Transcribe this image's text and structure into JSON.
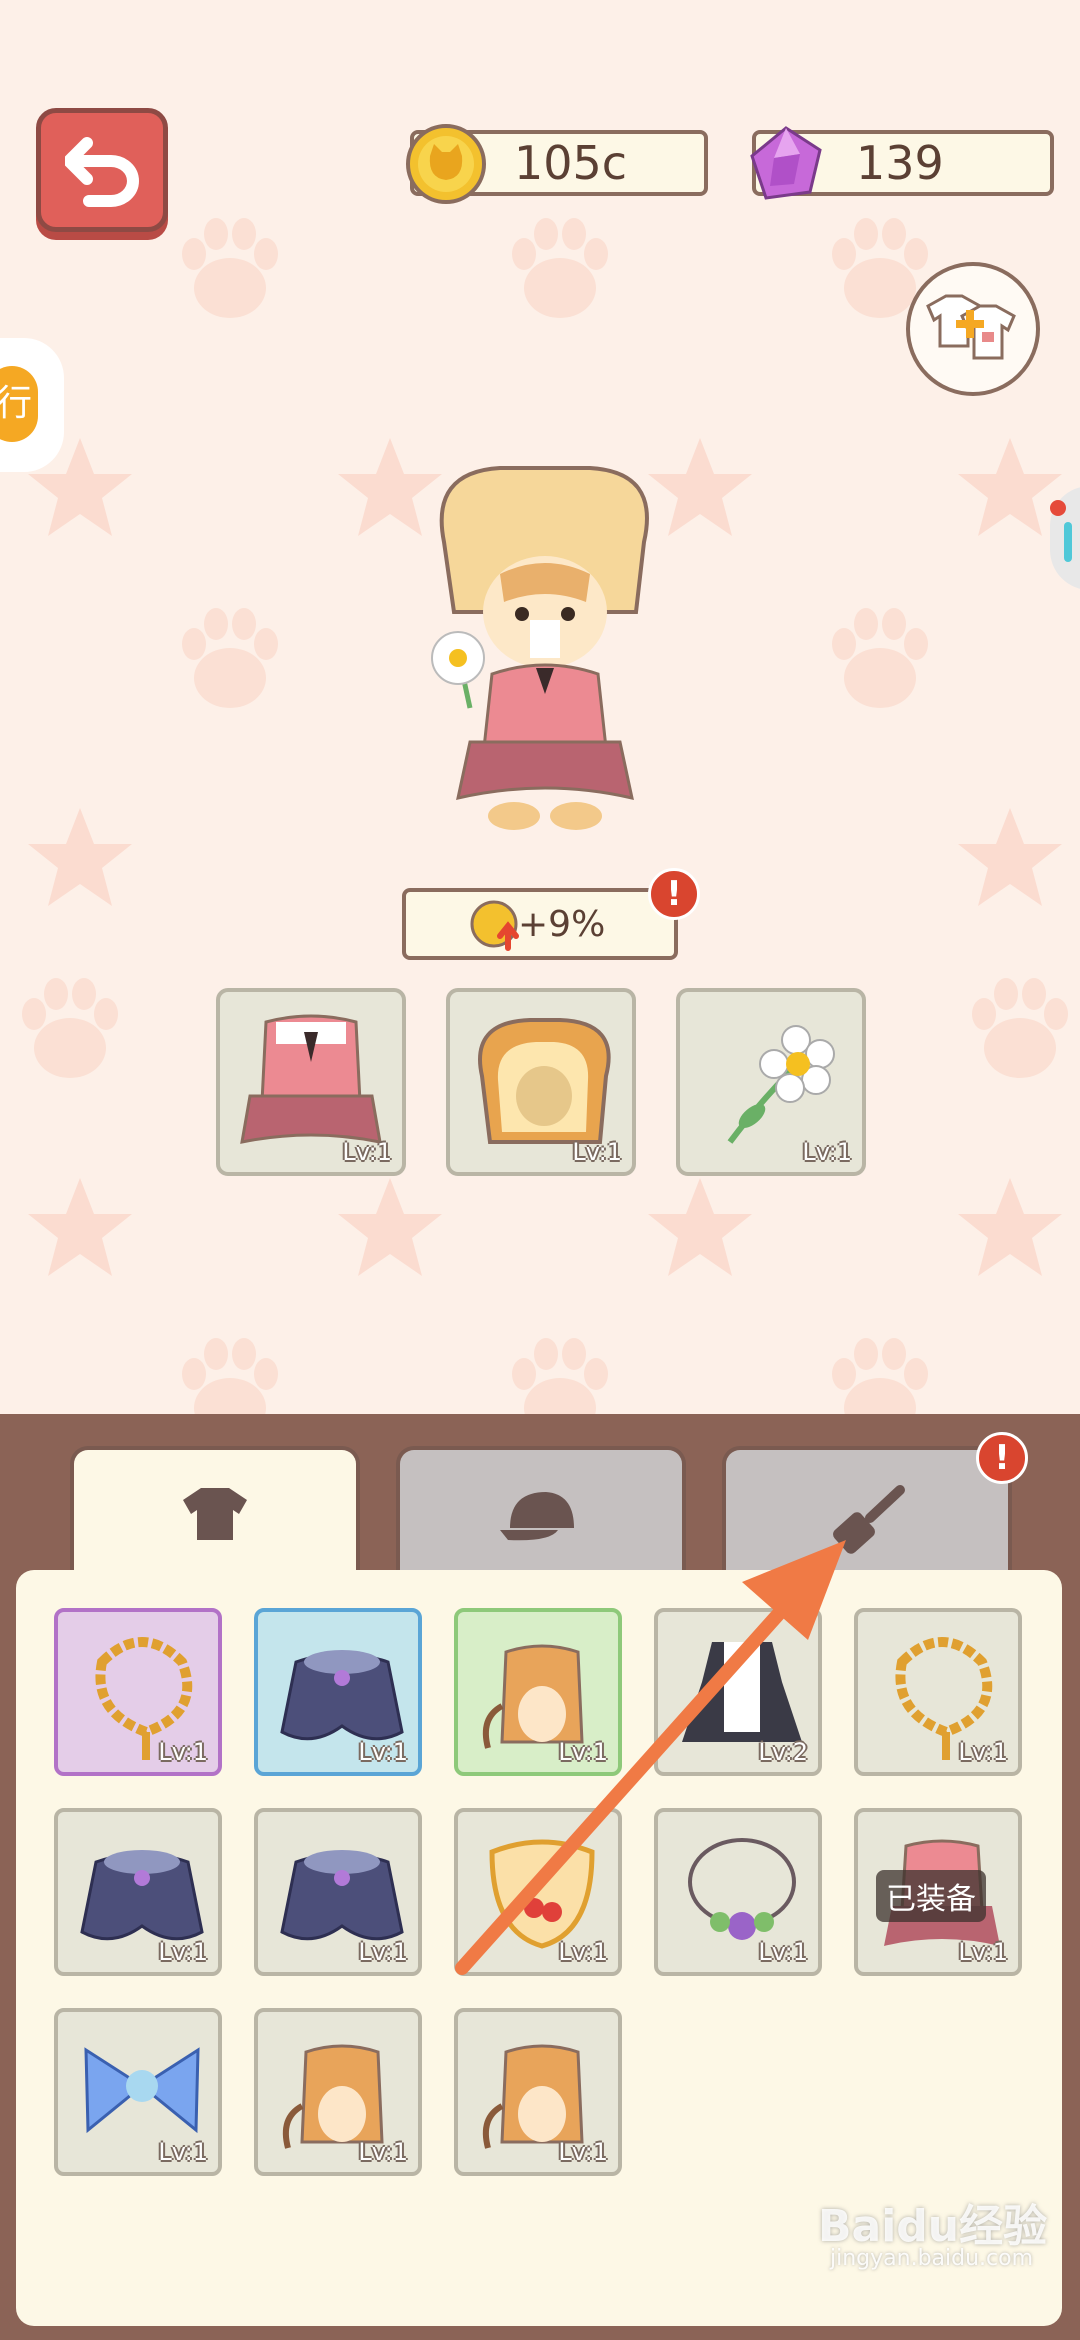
{
  "header": {
    "coins": "105c",
    "gems": "139"
  },
  "left_tab_glyph": "行",
  "bonus": {
    "text": "+9%",
    "alert": "!"
  },
  "equipped_slots": [
    {
      "name": "pink-uniform",
      "level": "Lv:1"
    },
    {
      "name": "toast-hat",
      "level": "Lv:1"
    },
    {
      "name": "daisy-flower",
      "level": "Lv:1"
    }
  ],
  "tabs": [
    {
      "name": "tops",
      "icon": "shirt-icon",
      "active": true
    },
    {
      "name": "hats",
      "icon": "cap-icon",
      "active": false
    },
    {
      "name": "held-items",
      "icon": "spatula-icon",
      "active": false,
      "alert": "!"
    }
  ],
  "items": [
    {
      "name": "bead-necklace",
      "level": "Lv:1",
      "rarity": "purple"
    },
    {
      "name": "navy-cape",
      "level": "Lv:1",
      "rarity": "blue"
    },
    {
      "name": "cat-body-suit",
      "level": "Lv:1",
      "rarity": "green"
    },
    {
      "name": "maid-dress",
      "level": "Lv:2",
      "rarity": "normal"
    },
    {
      "name": "bead-necklace",
      "level": "Lv:1",
      "rarity": "normal"
    },
    {
      "name": "navy-cape",
      "level": "Lv:1",
      "rarity": "normal"
    },
    {
      "name": "navy-cape",
      "level": "Lv:1",
      "rarity": "normal"
    },
    {
      "name": "cherry-bib",
      "level": "Lv:1",
      "rarity": "normal"
    },
    {
      "name": "flower-necklace",
      "level": "Lv:1",
      "rarity": "normal"
    },
    {
      "name": "pink-uniform",
      "level": "Lv:1",
      "rarity": "normal",
      "tag": "已装备"
    },
    {
      "name": "blue-bow",
      "level": "Lv:1",
      "rarity": "normal"
    },
    {
      "name": "cat-body-suit",
      "level": "Lv:1",
      "rarity": "normal"
    },
    {
      "name": "cat-body-suit",
      "level": "Lv:1",
      "rarity": "normal"
    }
  ],
  "watermark": {
    "main": "Baidu经验",
    "sub": "jingyan.baidu.com"
  },
  "colors": {
    "accent_orange": "#f07a45",
    "panel_brown": "#8b6356",
    "alert_red": "#d9452f"
  }
}
